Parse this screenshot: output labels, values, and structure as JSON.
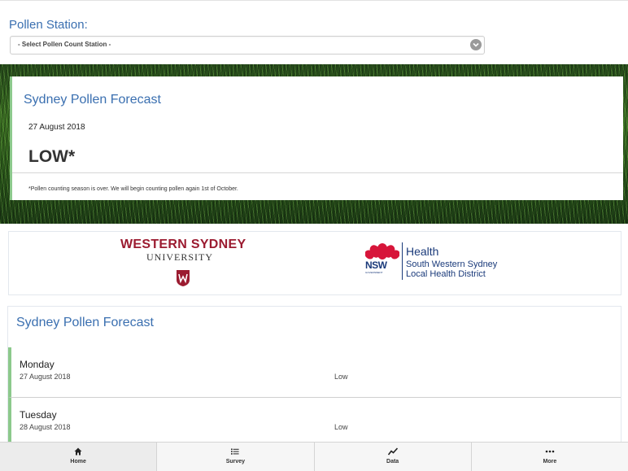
{
  "station": {
    "label": "Pollen Station:",
    "selected": "- Select Pollen Count Station -"
  },
  "current_forecast": {
    "title": "Sydney Pollen Forecast",
    "date": "27 August 2018",
    "level": "LOW*",
    "note": "*Pollen counting season is over. We will begin counting pollen again 1st of October."
  },
  "logos": {
    "wsu_line1": "WESTERN SYDNEY",
    "wsu_line2": "UNIVERSITY",
    "nsw_mark": "NSW",
    "nsw_gov": "GOVERNMENT",
    "health_title": "Health",
    "health_line1": "South Western Sydney",
    "health_line2": "Local Health District"
  },
  "daily": {
    "title": "Sydney Pollen Forecast",
    "items": [
      {
        "day": "Monday",
        "date": "27 August 2018",
        "level": "Low"
      },
      {
        "day": "Tuesday",
        "date": "28 August 2018",
        "level": "Low"
      }
    ]
  },
  "nav": {
    "items": [
      {
        "label": "Home",
        "icon": "home-icon"
      },
      {
        "label": "Survey",
        "icon": "list-icon"
      },
      {
        "label": "Data",
        "icon": "line-chart-icon"
      },
      {
        "label": "More",
        "icon": "more-icon"
      }
    ]
  },
  "colors": {
    "title_blue": "#3a6fb0",
    "accent_green": "#8cc98c",
    "wsu_red": "#9b1b30",
    "nsw_navy": "#1a3a7a"
  }
}
